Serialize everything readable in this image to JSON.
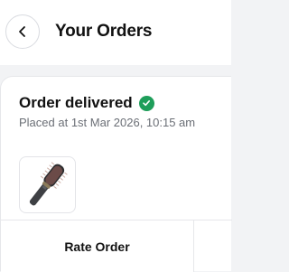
{
  "header": {
    "title": "Your Orders",
    "back_icon": "chevron-left-icon"
  },
  "order": {
    "status": "Order delivered",
    "status_icon": "check-circle-icon",
    "status_color": "#1e9e5a",
    "placed_text": "Placed at 1st Mar 2026, 10:15 am",
    "product_image": "hot-air-brush-image"
  },
  "actions": {
    "rate_label": "Rate Order"
  }
}
